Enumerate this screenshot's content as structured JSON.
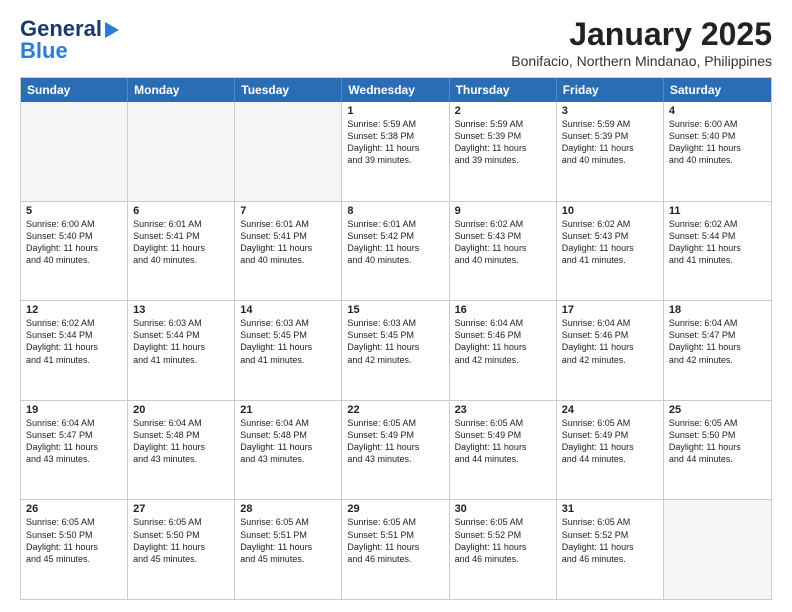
{
  "logo": {
    "line1": "General",
    "line2": "Blue"
  },
  "title": "January 2025",
  "subtitle": "Bonifacio, Northern Mindanao, Philippines",
  "header_days": [
    "Sunday",
    "Monday",
    "Tuesday",
    "Wednesday",
    "Thursday",
    "Friday",
    "Saturday"
  ],
  "weeks": [
    [
      {
        "day": "",
        "info": ""
      },
      {
        "day": "",
        "info": ""
      },
      {
        "day": "",
        "info": ""
      },
      {
        "day": "1",
        "info": "Sunrise: 5:59 AM\nSunset: 5:38 PM\nDaylight: 11 hours\nand 39 minutes."
      },
      {
        "day": "2",
        "info": "Sunrise: 5:59 AM\nSunset: 5:39 PM\nDaylight: 11 hours\nand 39 minutes."
      },
      {
        "day": "3",
        "info": "Sunrise: 5:59 AM\nSunset: 5:39 PM\nDaylight: 11 hours\nand 40 minutes."
      },
      {
        "day": "4",
        "info": "Sunrise: 6:00 AM\nSunset: 5:40 PM\nDaylight: 11 hours\nand 40 minutes."
      }
    ],
    [
      {
        "day": "5",
        "info": "Sunrise: 6:00 AM\nSunset: 5:40 PM\nDaylight: 11 hours\nand 40 minutes."
      },
      {
        "day": "6",
        "info": "Sunrise: 6:01 AM\nSunset: 5:41 PM\nDaylight: 11 hours\nand 40 minutes."
      },
      {
        "day": "7",
        "info": "Sunrise: 6:01 AM\nSunset: 5:41 PM\nDaylight: 11 hours\nand 40 minutes."
      },
      {
        "day": "8",
        "info": "Sunrise: 6:01 AM\nSunset: 5:42 PM\nDaylight: 11 hours\nand 40 minutes."
      },
      {
        "day": "9",
        "info": "Sunrise: 6:02 AM\nSunset: 5:43 PM\nDaylight: 11 hours\nand 40 minutes."
      },
      {
        "day": "10",
        "info": "Sunrise: 6:02 AM\nSunset: 5:43 PM\nDaylight: 11 hours\nand 41 minutes."
      },
      {
        "day": "11",
        "info": "Sunrise: 6:02 AM\nSunset: 5:44 PM\nDaylight: 11 hours\nand 41 minutes."
      }
    ],
    [
      {
        "day": "12",
        "info": "Sunrise: 6:02 AM\nSunset: 5:44 PM\nDaylight: 11 hours\nand 41 minutes."
      },
      {
        "day": "13",
        "info": "Sunrise: 6:03 AM\nSunset: 5:44 PM\nDaylight: 11 hours\nand 41 minutes."
      },
      {
        "day": "14",
        "info": "Sunrise: 6:03 AM\nSunset: 5:45 PM\nDaylight: 11 hours\nand 41 minutes."
      },
      {
        "day": "15",
        "info": "Sunrise: 6:03 AM\nSunset: 5:45 PM\nDaylight: 11 hours\nand 42 minutes."
      },
      {
        "day": "16",
        "info": "Sunrise: 6:04 AM\nSunset: 5:46 PM\nDaylight: 11 hours\nand 42 minutes."
      },
      {
        "day": "17",
        "info": "Sunrise: 6:04 AM\nSunset: 5:46 PM\nDaylight: 11 hours\nand 42 minutes."
      },
      {
        "day": "18",
        "info": "Sunrise: 6:04 AM\nSunset: 5:47 PM\nDaylight: 11 hours\nand 42 minutes."
      }
    ],
    [
      {
        "day": "19",
        "info": "Sunrise: 6:04 AM\nSunset: 5:47 PM\nDaylight: 11 hours\nand 43 minutes."
      },
      {
        "day": "20",
        "info": "Sunrise: 6:04 AM\nSunset: 5:48 PM\nDaylight: 11 hours\nand 43 minutes."
      },
      {
        "day": "21",
        "info": "Sunrise: 6:04 AM\nSunset: 5:48 PM\nDaylight: 11 hours\nand 43 minutes."
      },
      {
        "day": "22",
        "info": "Sunrise: 6:05 AM\nSunset: 5:49 PM\nDaylight: 11 hours\nand 43 minutes."
      },
      {
        "day": "23",
        "info": "Sunrise: 6:05 AM\nSunset: 5:49 PM\nDaylight: 11 hours\nand 44 minutes."
      },
      {
        "day": "24",
        "info": "Sunrise: 6:05 AM\nSunset: 5:49 PM\nDaylight: 11 hours\nand 44 minutes."
      },
      {
        "day": "25",
        "info": "Sunrise: 6:05 AM\nSunset: 5:50 PM\nDaylight: 11 hours\nand 44 minutes."
      }
    ],
    [
      {
        "day": "26",
        "info": "Sunrise: 6:05 AM\nSunset: 5:50 PM\nDaylight: 11 hours\nand 45 minutes."
      },
      {
        "day": "27",
        "info": "Sunrise: 6:05 AM\nSunset: 5:50 PM\nDaylight: 11 hours\nand 45 minutes."
      },
      {
        "day": "28",
        "info": "Sunrise: 6:05 AM\nSunset: 5:51 PM\nDaylight: 11 hours\nand 45 minutes."
      },
      {
        "day": "29",
        "info": "Sunrise: 6:05 AM\nSunset: 5:51 PM\nDaylight: 11 hours\nand 46 minutes."
      },
      {
        "day": "30",
        "info": "Sunrise: 6:05 AM\nSunset: 5:52 PM\nDaylight: 11 hours\nand 46 minutes."
      },
      {
        "day": "31",
        "info": "Sunrise: 6:05 AM\nSunset: 5:52 PM\nDaylight: 11 hours\nand 46 minutes."
      },
      {
        "day": "",
        "info": ""
      }
    ]
  ]
}
